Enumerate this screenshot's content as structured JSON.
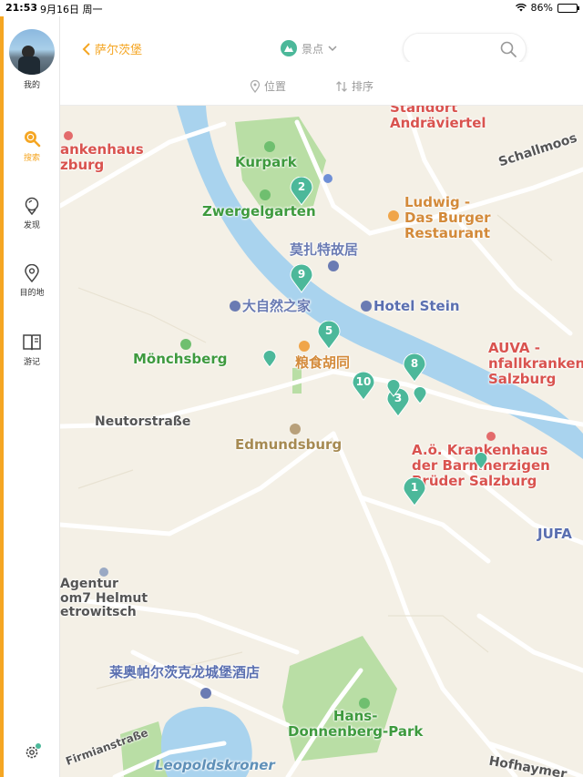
{
  "status_bar": {
    "time": "21:53",
    "date": "9月16日 周一",
    "battery": "86%"
  },
  "sidebar": {
    "profile_label": "我的",
    "items": [
      {
        "label": "搜索",
        "icon": "search-icon",
        "active": true
      },
      {
        "label": "发现",
        "icon": "discover-icon",
        "active": false
      },
      {
        "label": "目的地",
        "icon": "location-icon",
        "active": false
      },
      {
        "label": "游记",
        "icon": "book-icon",
        "active": false
      }
    ],
    "settings_icon": "gear-icon"
  },
  "header": {
    "back_label": "萨尔茨堡",
    "category_label": "景点",
    "search_placeholder": ""
  },
  "filters": {
    "location": "位置",
    "sort": "排序"
  },
  "colors": {
    "accent": "#f5a623",
    "pin": "#4cb89a",
    "water": "#a9d3ee"
  },
  "map": {
    "labels": [
      {
        "text": "Standort\nAndräviertel",
        "style": "red"
      },
      {
        "text": "ankenhaus\nzburg",
        "style": "red"
      },
      {
        "text": "Schallmoos",
        "style": "dark"
      },
      {
        "text": "Kurpark",
        "style": "green"
      },
      {
        "text": "Zwergelgarten",
        "style": "green"
      },
      {
        "text": "Ludwig -\nDas Burger\nRestaurant",
        "style": "orange"
      },
      {
        "text": "莫扎特故居",
        "style": "blue"
      },
      {
        "text": "大自然之家",
        "style": "blue"
      },
      {
        "text": "Hotel Stein",
        "style": "navy"
      },
      {
        "text": "Mönchsberg",
        "style": "green"
      },
      {
        "text": "粮食胡同",
        "style": "orange"
      },
      {
        "text": "AUVA -\nnfallkrankenhaus\nSalzburg",
        "style": "red"
      },
      {
        "text": "Neutorstraße",
        "style": "dark"
      },
      {
        "text": "Edmundsburg",
        "style": "olive"
      },
      {
        "text": "A.ö. Krankenhaus\nder Barmherzigen\nBrüder Salzburg",
        "style": "red"
      },
      {
        "text": "JUFA",
        "style": "navy"
      },
      {
        "text": "Agentur\nom7 Helmut\netrowitsch",
        "style": "gray"
      },
      {
        "text": "莱奥帕尔茨克龙城堡酒店",
        "style": "navy"
      },
      {
        "text": "Hans-\nDonnenberg-Park",
        "style": "green"
      },
      {
        "text": "Firmianstraße",
        "style": "dark"
      },
      {
        "text": "Leopoldskroner",
        "style": "lightblue"
      },
      {
        "text": "Hofhaymer",
        "style": "dark"
      }
    ],
    "pins": [
      "2",
      "9",
      "5",
      "8",
      "10",
      "3",
      "1"
    ]
  }
}
